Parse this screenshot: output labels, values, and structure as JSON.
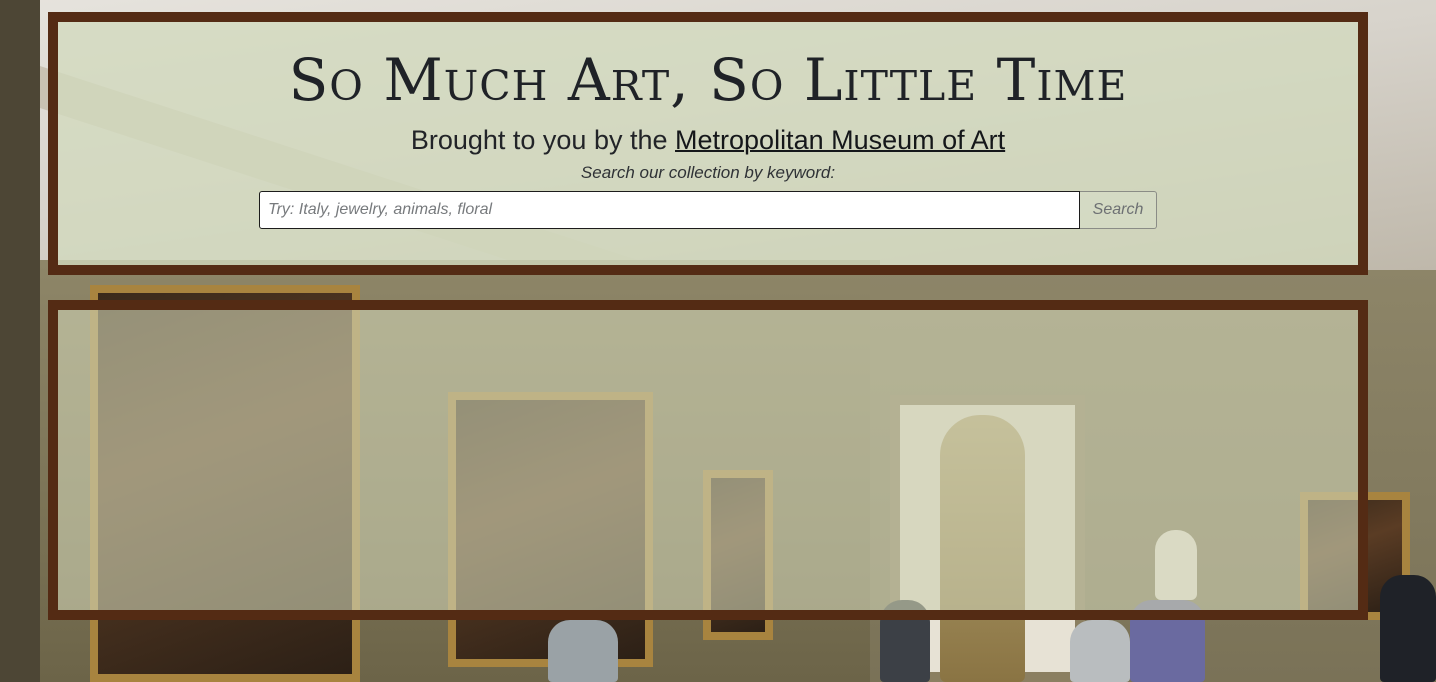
{
  "header": {
    "title": "So Much Art, So Little Time",
    "tagline_prefix": "Brought to you by the ",
    "museum_link": "Metropolitan Museum of Art"
  },
  "search": {
    "prompt": "Search our collection by keyword:",
    "placeholder": "Try: Italy, jewelry, animals, floral",
    "value": "",
    "button_label": "Search"
  },
  "results": {
    "items": []
  },
  "colors": {
    "panel_border": "#542b14",
    "panel_tint": "#d2dabe",
    "text": "#1f2227"
  }
}
